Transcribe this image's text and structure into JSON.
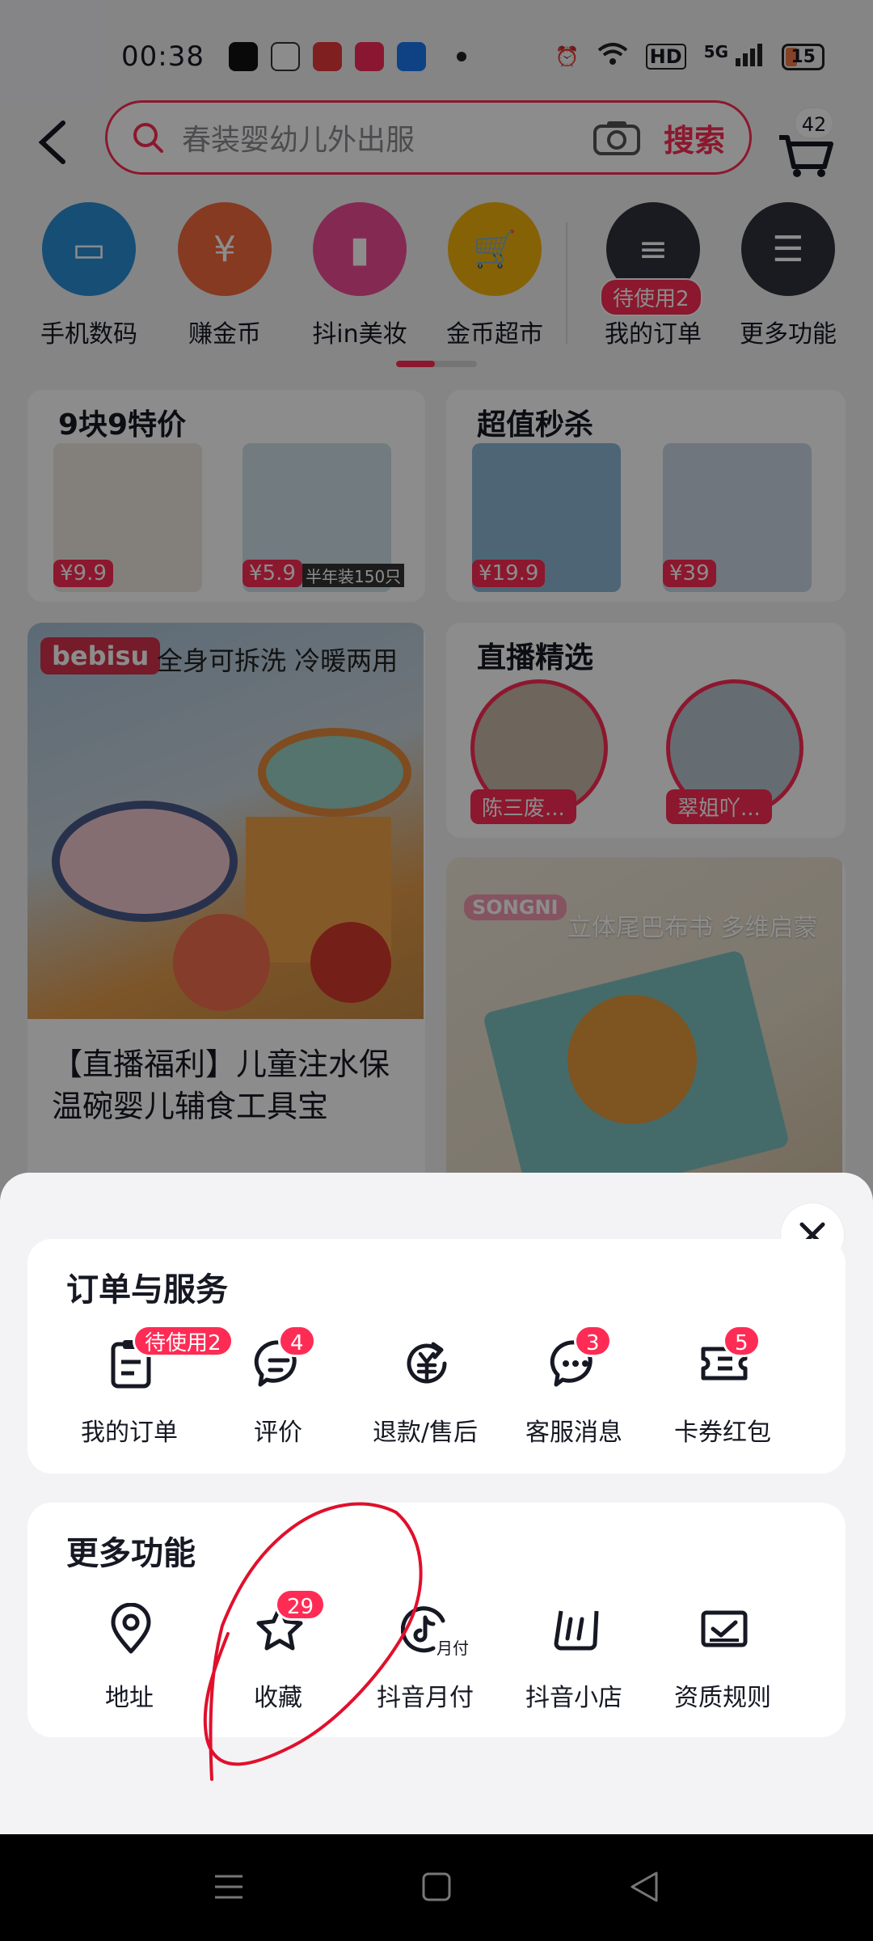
{
  "status_bar": {
    "time": "00:38",
    "network": "5G",
    "hd": "HD",
    "battery": "15"
  },
  "header": {
    "search_placeholder": "春装婴幼儿外出服",
    "search_button": "搜索",
    "cart_count": "42"
  },
  "categories": [
    {
      "label": "手机数码",
      "color": "#2b8fd6"
    },
    {
      "label": "赚金币",
      "color": "#f46a3c"
    },
    {
      "label": "抖in美妆",
      "color": "#f04e96"
    },
    {
      "label": "金币超市",
      "color": "#f5b20e"
    },
    {
      "label": "我的订单",
      "color": "#30323d",
      "badge": "待使用2"
    },
    {
      "label": "更多功能",
      "color": "#30323d"
    }
  ],
  "feed": {
    "deal_title": "9块9特价",
    "deal_prices": [
      "¥9.9",
      "¥5.9"
    ],
    "deal_caption": "半年装150只",
    "flash_title": "超值秒杀",
    "flash_prices": [
      "¥19.9",
      "¥39"
    ],
    "promo_brand": "bebisu",
    "promo_slogan": "全身可拆洗 冷暖两用",
    "promo_desc": "【直播福利】儿童注水保温碗婴儿辅食工具宝",
    "live_title": "直播精选",
    "live_tags": [
      "陈三废...",
      "翠姐吖..."
    ],
    "book_brand": "SONGNI",
    "book_slogan": "立体尾巴布书 多维启蒙"
  },
  "sheet": {
    "orders_title": "订单与服务",
    "orders": [
      {
        "label": "我的订单",
        "icon": "clipboard-icon",
        "badge": "待使用2"
      },
      {
        "label": "评价",
        "icon": "comment-icon",
        "badge": "4"
      },
      {
        "label": "退款/售后",
        "icon": "refund-icon",
        "badge": ""
      },
      {
        "label": "客服消息",
        "icon": "chat-icon",
        "badge": "3"
      },
      {
        "label": "卡券红包",
        "icon": "ticket-icon",
        "badge": "5"
      }
    ],
    "more_title": "更多功能",
    "more": [
      {
        "label": "地址",
        "icon": "location-icon",
        "badge": ""
      },
      {
        "label": "收藏",
        "icon": "star-icon",
        "badge": "29"
      },
      {
        "label": "抖音月付",
        "icon": "monthly-pay-icon",
        "badge": "",
        "sub": "月付"
      },
      {
        "label": "抖音小店",
        "icon": "shop-icon",
        "badge": ""
      },
      {
        "label": "资质规则",
        "icon": "license-icon",
        "badge": ""
      }
    ]
  },
  "colors": {
    "accent": "#fe2c55",
    "sheet_bg": "#f3f3f5"
  }
}
